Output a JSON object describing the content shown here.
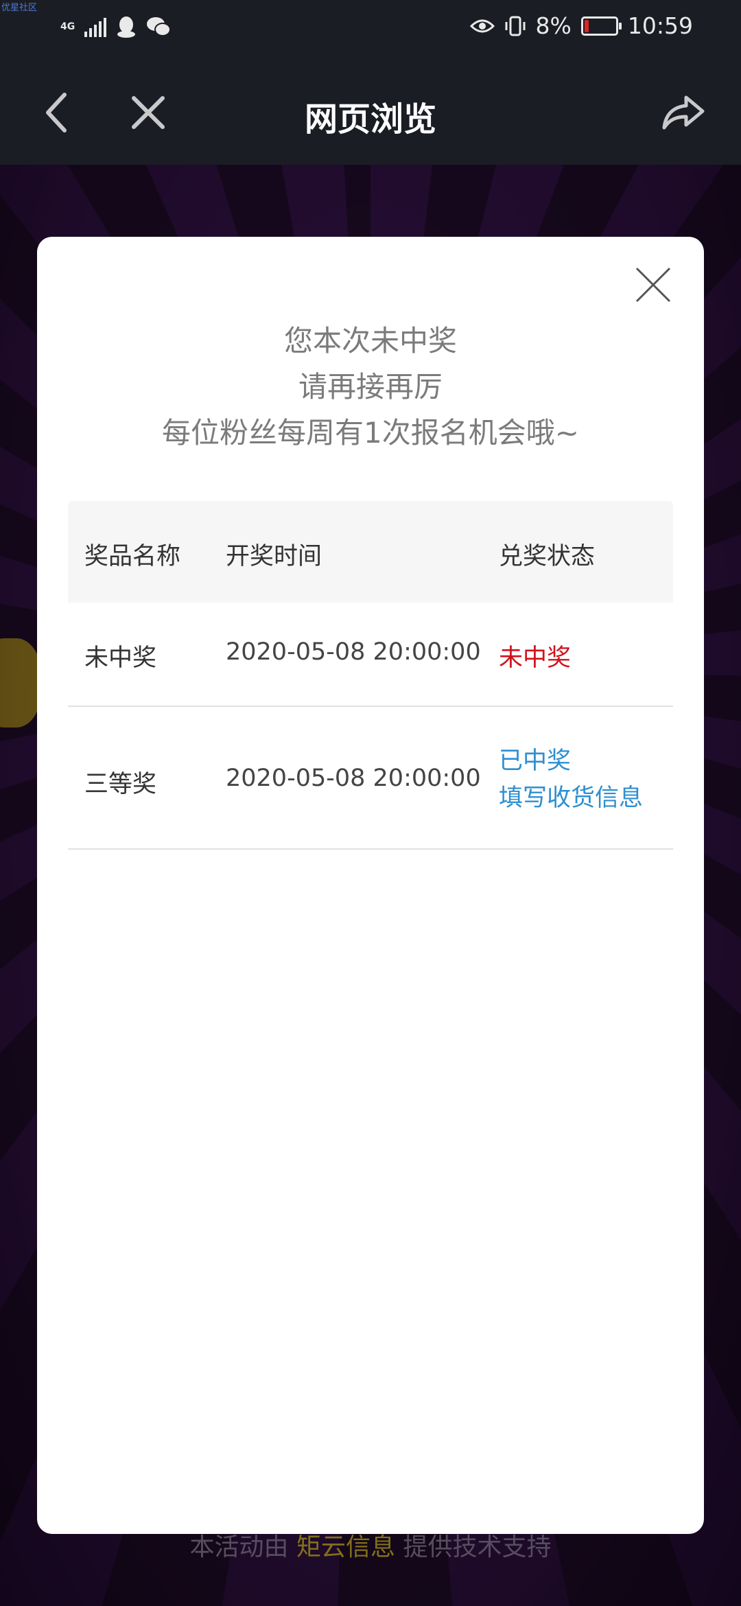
{
  "status_bar": {
    "watermark": "优星社区",
    "network": "4G",
    "battery_percent": "8%",
    "battery_level": 0.08,
    "time": "10:59"
  },
  "nav": {
    "title": "网页浏览"
  },
  "background": {
    "footer_prefix": "本活动由",
    "footer_brand": "矩云信息",
    "footer_suffix": "提供技术支持"
  },
  "modal": {
    "line1": "您本次未中奖",
    "line2": "请再接再厉",
    "line3": "每位粉丝每周有1次报名机会哦~",
    "table": {
      "headers": [
        "奖品名称",
        "开奖时间",
        "兑奖状态"
      ],
      "rows": [
        {
          "prize": "未中奖",
          "time": "2020-05-08 20:00:00",
          "status": "未中奖"
        },
        {
          "prize": "三等奖",
          "time": "2020-05-08 20:00:00",
          "status": "已中奖",
          "action": "填写收货信息"
        }
      ]
    }
  },
  "colors": {
    "lose": "#d0121b",
    "win": "#2d8fd0"
  }
}
